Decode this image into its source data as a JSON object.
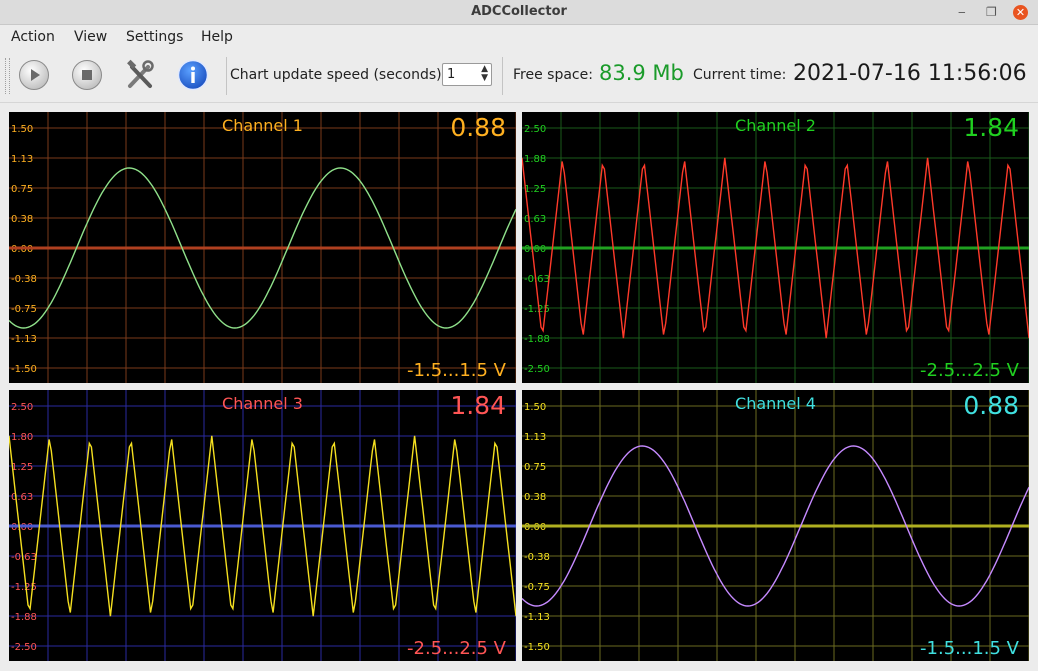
{
  "window": {
    "title": "ADCCollector"
  },
  "menu": {
    "items": [
      "Action",
      "View",
      "Settings",
      "Help"
    ]
  },
  "toolbar": {
    "speed_label": "Chart update speed (seconds):",
    "speed_value": "1",
    "free_space_label": "Free space:",
    "free_space_value": "83.9 Mb",
    "current_time_label": "Current time:",
    "current_time_value": "2021-07-16 11:56:06",
    "icons": [
      "play-icon",
      "stop-icon",
      "tools-icon",
      "info-icon"
    ]
  },
  "chart_data": [
    {
      "type": "line",
      "title": "Channel 1",
      "current_value": "0.88",
      "range_label": "-1.5...1.5 V",
      "ylim": [
        -1.5,
        1.5
      ],
      "yticks": [
        "1.50",
        "1.13",
        "0.75",
        "0.38",
        "0.00",
        "-0.38",
        "-0.75",
        "-1.13",
        "-1.50"
      ],
      "waveform": "sine",
      "amplitude": 1.0,
      "cycles": 2.4,
      "phase_deg": -115,
      "samples": 240,
      "series_color": "#8fe08a",
      "colors": {
        "title": "#ffb020",
        "value": "#ffb020",
        "range": "#ffb020",
        "ticks": "#ffb020",
        "grid": "#7a3a1a",
        "zero": "#b04020"
      }
    },
    {
      "type": "line",
      "title": "Channel 2",
      "current_value": "1.84",
      "range_label": "-2.5...2.5 V",
      "ylim": [
        -2.5,
        2.5
      ],
      "yticks": [
        "2.50",
        "1.88",
        "1.25",
        "0.63",
        "0.00",
        "-0.63",
        "-1.25",
        "-1.88",
        "-2.50"
      ],
      "waveform": "triangle",
      "amplitude": 1.88,
      "cycles": 12.5,
      "phase_deg": 90,
      "samples": 240,
      "series_color": "#ff3a2a",
      "colors": {
        "title": "#20d020",
        "value": "#20d020",
        "range": "#20d020",
        "ticks": "#20d020",
        "grid": "#1a5a1a",
        "zero": "#20a020"
      }
    },
    {
      "type": "line",
      "title": "Channel 3",
      "current_value": "1.84",
      "range_label": "-2.5...2.5 V",
      "ylim": [
        -2.5,
        2.5
      ],
      "yticks": [
        "2.50",
        "1.80",
        "1.25",
        "0.63",
        "0.00",
        "-0.63",
        "-1.25",
        "-1.88",
        "-2.50"
      ],
      "waveform": "triangle",
      "amplitude": 1.88,
      "cycles": 12.5,
      "phase_deg": 90,
      "samples": 240,
      "series_color": "#f5e020",
      "colors": {
        "title": "#ff5555",
        "value": "#ff5555",
        "range": "#ff5555",
        "ticks": "#ff5555",
        "grid": "#2a2aa0",
        "zero": "#4a5ad0"
      }
    },
    {
      "type": "line",
      "title": "Channel 4",
      "current_value": "0.88",
      "range_label": "-1.5...1.5 V",
      "ylim": [
        -1.5,
        1.5
      ],
      "yticks": [
        "1.50",
        "1.13",
        "0.75",
        "0.38",
        "0.00",
        "-0.38",
        "-0.75",
        "-1.13",
        "-1.50"
      ],
      "waveform": "sine",
      "amplitude": 1.0,
      "cycles": 2.4,
      "phase_deg": -115,
      "samples": 240,
      "series_color": "#c58aff",
      "colors": {
        "title": "#40e0e0",
        "value": "#40e0e0",
        "range": "#40e0e0",
        "ticks": "#f5e020",
        "grid": "#6a6a20",
        "zero": "#b0b020"
      }
    }
  ]
}
